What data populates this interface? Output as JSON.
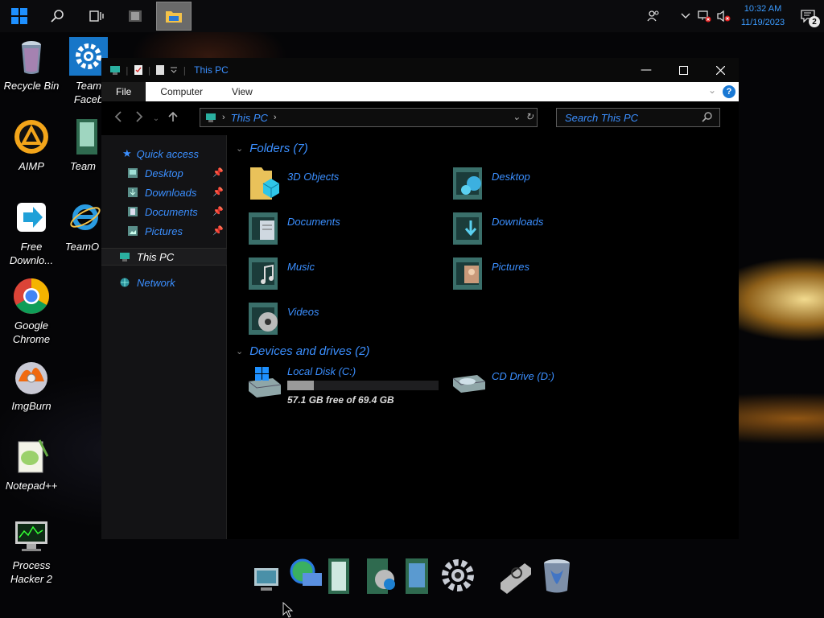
{
  "taskbar": {
    "start": "windows-start",
    "clock": {
      "time": "10:32 AM",
      "date": "11/19/2023"
    },
    "notification_count": "2"
  },
  "desktop_icons": [
    {
      "label": "Recycle Bin",
      "icon": "recycle-bin-icon"
    },
    {
      "label": "Team Faceb",
      "icon": "settings-gear-icon"
    },
    {
      "label": "AIMP",
      "icon": "aimp-icon"
    },
    {
      "label": "Team",
      "icon": "team-icon"
    },
    {
      "label": "Free Downlo...",
      "icon": "free-download-manager-icon"
    },
    {
      "label": "TeamO",
      "icon": "internet-explorer-icon"
    },
    {
      "label": "Google Chrome",
      "icon": "chrome-icon"
    },
    {
      "label": "ImgBurn",
      "icon": "imgburn-icon"
    },
    {
      "label": "Notepad++",
      "icon": "notepadpp-icon"
    },
    {
      "label": "Process Hacker 2",
      "icon": "process-hacker-icon"
    }
  ],
  "explorer": {
    "title": "This PC",
    "ribbon_tabs": [
      "File",
      "Computer",
      "View"
    ],
    "address": {
      "path": "This PC"
    },
    "search_placeholder": "Search This PC",
    "nav_pane": {
      "quick_access": "Quick access",
      "pinned": [
        "Desktop",
        "Downloads",
        "Documents",
        "Pictures"
      ],
      "this_pc": "This PC",
      "network": "Network"
    },
    "folders_header": "Folders (7)",
    "folders": [
      "3D Objects",
      "Desktop",
      "Documents",
      "Downloads",
      "Music",
      "Pictures",
      "Videos"
    ],
    "devices_header": "Devices and drives (2)",
    "drives": [
      {
        "name": "Local Disk (C:)",
        "free": "57.1 GB free of 69.4 GB",
        "used_fraction": 0.177
      },
      {
        "name": "CD Drive (D:)"
      }
    ]
  },
  "dock": [
    "computer-icon",
    "network-icon",
    "documents-icon",
    "media-player-icon",
    "pictures-icon",
    "settings-icon",
    "shutdown-icon",
    "recycle-bin-icon"
  ],
  "colors": {
    "accent": "#3b8fff",
    "window_bg": "#000000",
    "nav_bg": "#131315"
  }
}
